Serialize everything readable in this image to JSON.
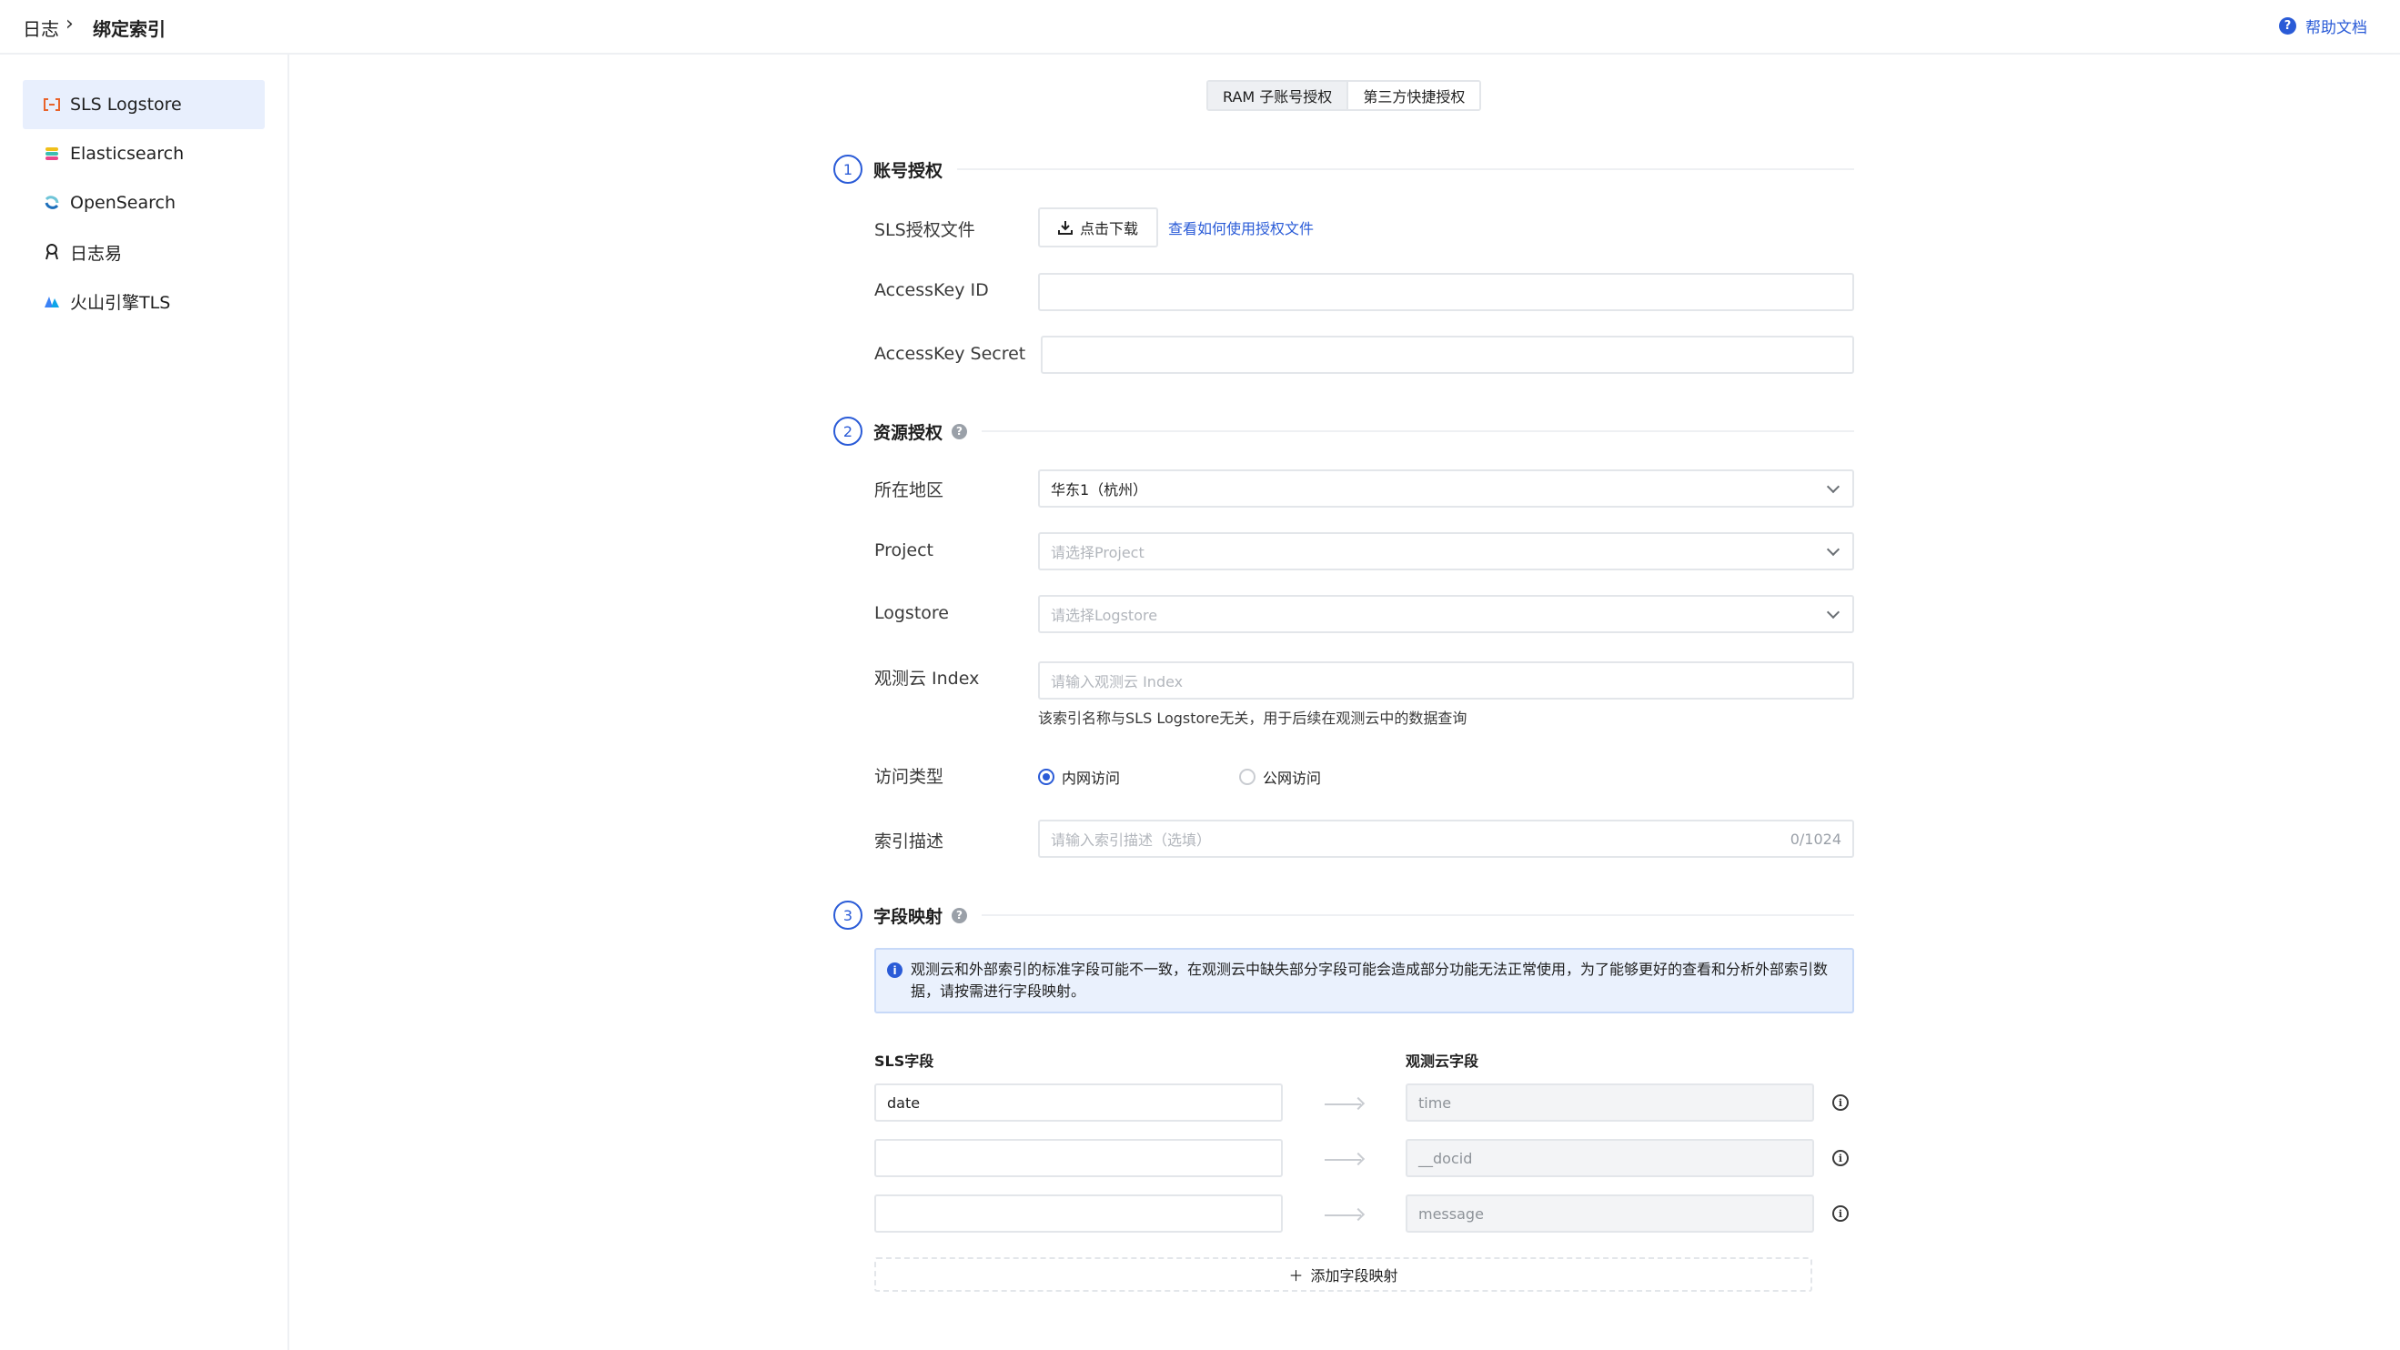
{
  "breadcrumb": {
    "root": "日志",
    "separator": "›",
    "current": "绑定索引"
  },
  "help": {
    "label": "帮助文档",
    "icon": "question-circle-icon"
  },
  "sidebar": {
    "items": [
      {
        "label": "SLS Logstore",
        "icon": "sls-logo-icon",
        "active": true
      },
      {
        "label": "Elasticsearch",
        "icon": "elasticsearch-logo-icon",
        "active": false
      },
      {
        "label": "OpenSearch",
        "icon": "opensearch-logo-icon",
        "active": false
      },
      {
        "label": "日志易",
        "icon": "rizhiyi-logo-icon",
        "active": false
      },
      {
        "label": "火山引擎TLS",
        "icon": "volcengine-logo-icon",
        "active": false
      }
    ]
  },
  "tabs": [
    {
      "label": "RAM 子账号授权",
      "active": true
    },
    {
      "label": "第三方快捷授权",
      "active": false
    }
  ],
  "section1": {
    "step": "1",
    "title": "账号授权",
    "file_label": "SLS授权文件",
    "download_button": "点击下载",
    "help_link": "查看如何使用授权文件",
    "access_key_id_label": "AccessKey ID",
    "access_key_id_value": "",
    "access_key_secret_label": "AccessKey Secret",
    "access_key_secret_value": ""
  },
  "section2": {
    "step": "2",
    "title": "资源授权",
    "region_label": "所在地区",
    "region_value": "华东1（杭州）",
    "project_label": "Project",
    "project_placeholder": "请选择Project",
    "logstore_label": "Logstore",
    "logstore_placeholder": "请选择Logstore",
    "index_label": "观测云 Index",
    "index_placeholder": "请输入观测云 Index",
    "index_hint": "该索引名称与SLS Logstore无关，用于后续在观测云中的数据查询",
    "access_type_label": "访问类型",
    "access_options": [
      {
        "label": "内网访问",
        "checked": true
      },
      {
        "label": "公网访问",
        "checked": false
      }
    ],
    "description_label": "索引描述",
    "description_placeholder": "请输入索引描述（选填）",
    "description_count": "0/1024"
  },
  "section3": {
    "step": "3",
    "title": "字段映射",
    "notice": "观测云和外部索引的标准字段可能不一致，在观测云中缺失部分字段可能会造成部分功能无法正常使用，为了能够更好的查看和分析外部索引数据，请按需进行字段映射。",
    "sls_column": "SLS字段",
    "guance_column": "观测云字段",
    "rows": [
      {
        "sls": "date",
        "guance": "time"
      },
      {
        "sls": "",
        "guance": "__docid"
      },
      {
        "sls": "",
        "guance": "message"
      }
    ],
    "add_button": "添加字段映射"
  }
}
